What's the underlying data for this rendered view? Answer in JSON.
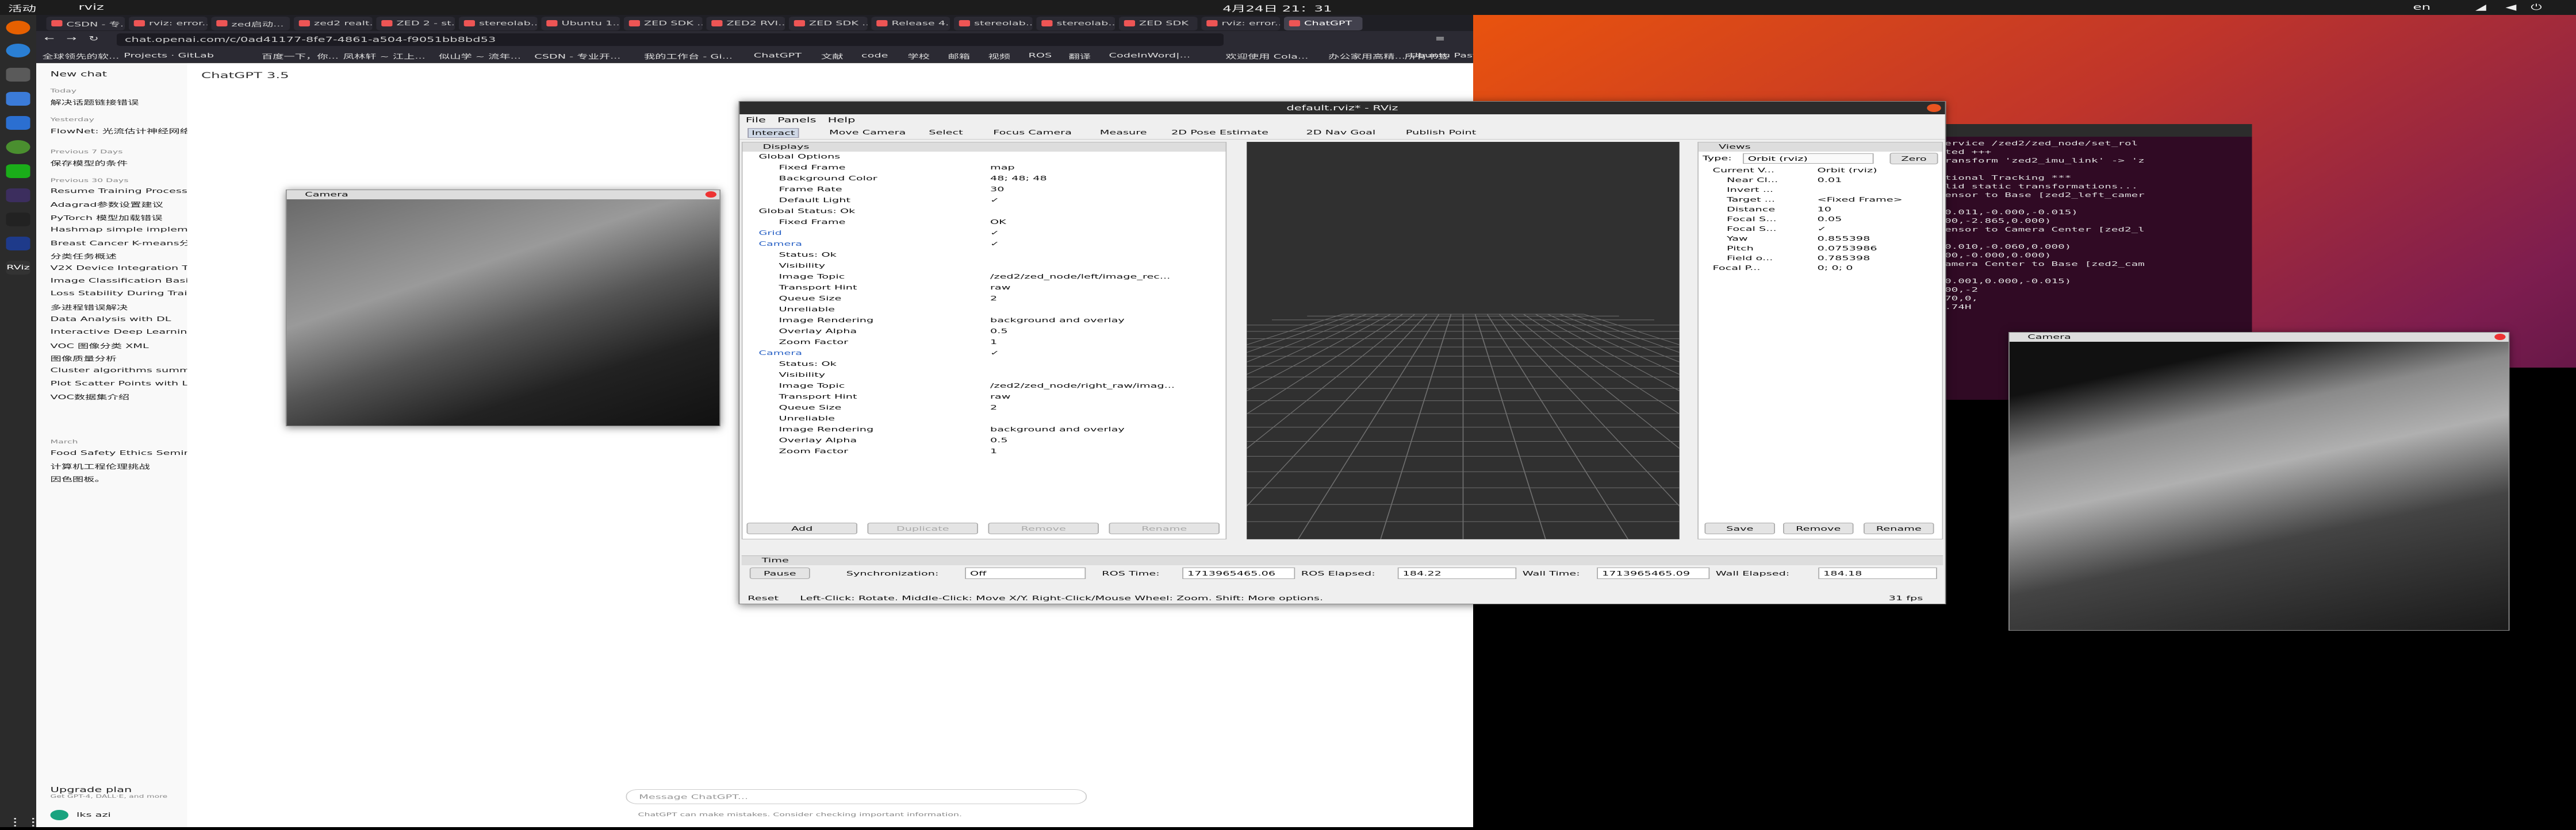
{
  "topbar": {
    "activities": "活动",
    "app": "rviz",
    "clock": "4月24日 21：31",
    "lang": "en"
  },
  "browser": {
    "tabs": [
      "CSDN - 专...",
      "rviz: error...",
      "zed启动...",
      "zed2 realt...",
      "ZED 2 - st...",
      "stereolab...",
      "Ubuntu 1...",
      "ZED SDK ...",
      "ZED2 RVI...",
      "ZED SDK ...",
      "Release 4...",
      "stereolab...",
      "stereolab...",
      "ZED SDK",
      "rviz: error...",
      "ChatGPT"
    ],
    "url": "chat.openai.com/c/0ad41177-8fe7-4861-a504-f9051bb8bd53",
    "bookmarks": [
      "全球领先的软...",
      "Projects · GitLab",
      "百度一下，你...",
      "凤林轩 ~ 江上...",
      "似山学 ~ 流年...",
      "CSDN - 专业开...",
      "我的工作台 - Gi...",
      "ChatGPT",
      "文献",
      "code",
      "学校",
      "邮箱",
      "视频",
      "ROS",
      "翻译",
      "CodeInWord|...",
      "欢迎使用 Cola...",
      "办公家用高精...",
      "Ubuntu Paste..."
    ],
    "other_bookmarks": "所有书签"
  },
  "chatgpt": {
    "new_chat": "New chat",
    "model": "ChatGPT 3.5",
    "today": "Today",
    "today_items": [
      "解决话题链接错误"
    ],
    "yesterday": "Yesterday",
    "yesterday_items": [
      "FlowNet: 光流估计神经网络"
    ],
    "prev7": "Previous 7 Days",
    "prev7_items": [
      "保存模型的条件"
    ],
    "prev30": "Previous 30 Days",
    "prev30_items": [
      "Resume Training Process",
      "Adagrad参数设置建议",
      "PyTorch 模型加载错误",
      "Hashmap simple implementati...",
      "Breast Cancer K-means分类",
      "分类任务概述",
      "V2X Device Integration Task",
      "Image Classification Basics",
      "Loss Stability During Training",
      "多进程错误解决",
      "Data Analysis with DL",
      "Interactive Deep Learning Websi...",
      "VOC 图像分类 XML",
      "图像质量分析",
      "Cluster algorithms summary.",
      "Plot Scatter Points with Lines",
      "VOC数据集介绍"
    ],
    "march": "March",
    "march_items": [
      "Food Safety Ethics Seminar",
      "计算机工程伦理挑战",
      "因色图板。"
    ],
    "upgrade": "Upgrade plan",
    "upgrade_sub": "Get GPT-4, DALL·E, and more",
    "user": "lks azi",
    "message_placeholder": "Message ChatGPT...",
    "disclaimer": "ChatGPT can make mistakes. Consider checking important information."
  },
  "camera_left": {
    "title": "Camera"
  },
  "rviz": {
    "title": "default.rviz* - RViz",
    "menu": [
      "File",
      "Panels",
      "Help"
    ],
    "tools": [
      "Interact",
      "Move Camera",
      "Select",
      "Focus Camera",
      "Measure",
      "2D Pose Estimate",
      "2D Nav Goal",
      "Publish Point"
    ],
    "displays_title": "Displays",
    "displays": [
      {
        "k": "Global Options",
        "v": ""
      },
      {
        "k": "Fixed Frame",
        "v": "map"
      },
      {
        "k": "Background Color",
        "v": "48; 48; 48"
      },
      {
        "k": "Frame Rate",
        "v": "30"
      },
      {
        "k": "Default Light",
        "v": "✓"
      },
      {
        "k": "Global Status: Ok",
        "v": ""
      },
      {
        "k": "Fixed Frame",
        "v": "OK"
      },
      {
        "k": "Grid",
        "v": "✓"
      },
      {
        "k": "Camera",
        "v": "✓"
      },
      {
        "k": "Status: Ok",
        "v": ""
      },
      {
        "k": "Visibility",
        "v": ""
      },
      {
        "k": "Image Topic",
        "v": "/zed2/zed_node/left/image_rec..."
      },
      {
        "k": "Transport Hint",
        "v": "raw"
      },
      {
        "k": "Queue Size",
        "v": "2"
      },
      {
        "k": "Unreliable",
        "v": ""
      },
      {
        "k": "Image Rendering",
        "v": "background and overlay"
      },
      {
        "k": "Overlay Alpha",
        "v": "0.5"
      },
      {
        "k": "Zoom Factor",
        "v": "1"
      },
      {
        "k": "Camera",
        "v": "✓"
      },
      {
        "k": "Status: Ok",
        "v": ""
      },
      {
        "k": "Visibility",
        "v": ""
      },
      {
        "k": "Image Topic",
        "v": "/zed2/zed_node/right_raw/imag..."
      },
      {
        "k": "Transport Hint",
        "v": "raw"
      },
      {
        "k": "Queue Size",
        "v": "2"
      },
      {
        "k": "Unreliable",
        "v": ""
      },
      {
        "k": "Image Rendering",
        "v": "background and overlay"
      },
      {
        "k": "Overlay Alpha",
        "v": "0.5"
      },
      {
        "k": "Zoom Factor",
        "v": "1"
      }
    ],
    "display_buttons": [
      "Add",
      "Duplicate",
      "Remove",
      "Rename"
    ],
    "views_title": "Views",
    "views_type_label": "Type:",
    "views_type": "Orbit (rviz)",
    "views_zero": "Zero",
    "views": [
      {
        "k": "Current V...",
        "v": "Orbit (rviz)"
      },
      {
        "k": "Near Cl...",
        "v": "0.01"
      },
      {
        "k": "Invert ...",
        "v": ""
      },
      {
        "k": "Target ...",
        "v": "<Fixed Frame>"
      },
      {
        "k": "Distance",
        "v": "10"
      },
      {
        "k": "Focal S...",
        "v": "0.05"
      },
      {
        "k": "Focal S...",
        "v": "✓"
      },
      {
        "k": "Yaw",
        "v": "0.855398"
      },
      {
        "k": "Pitch",
        "v": "0.0753986"
      },
      {
        "k": "Field o...",
        "v": "0.785398"
      },
      {
        "k": "Focal P...",
        "v": "0; 0; 0"
      }
    ],
    "views_buttons": [
      "Save",
      "Remove",
      "Rename"
    ],
    "time_title": "Time",
    "pause": "Pause",
    "sync_label": "Synchronization:",
    "sync_value": "Off",
    "ros_time_label": "ROS Time:",
    "ros_time": "1713965465.06",
    "ros_elapsed_label": "ROS Elapsed:",
    "ros_elapsed": "184.22",
    "wall_time_label": "Wall Time:",
    "wall_time": "1713965465.09",
    "wall_elapsed_label": "Wall Elapsed:",
    "wall_elapsed": "184.18",
    "reset": "Reset",
    "status_hint": "Left-Click: Rotate. Middle-Click: Move X/Y. Right-Click/Mouse Wheel: Zoom. Shift: More options.",
    "fps": "31 fps"
  },
  "terminal": {
    "lines": [
      "service /zed2/zed_node/set_rol",
      "rted +++",
      "transform 'zed2_imu_link' -> 'z",
      "",
      "itional Tracking ***",
      "alid static transformations...",
      "Sensor to Base [zed2_left_camer",
      "",
      "(0.011,-0.000,-0.015)",
      "000,-2.865,0.000)",
      "Sensor to Camera Center [zed2_l",
      "",
      "(0.010,-0.060,0.000)",
      "000,-0.000,0.000)",
      "Camera Center to Base [zed2_cam",
      "",
      "(0.001,0.000,-0.015)",
      "000,-2",
      "270,0,",
      "1.74H"
    ]
  },
  "camera_right": {
    "title": "Camera"
  },
  "colors": {
    "ubuntu_orange": "#e95420",
    "rviz_bg": "#303030",
    "desktop_top": "#e9530e",
    "desktop_bottom": "#2c0a2c"
  }
}
